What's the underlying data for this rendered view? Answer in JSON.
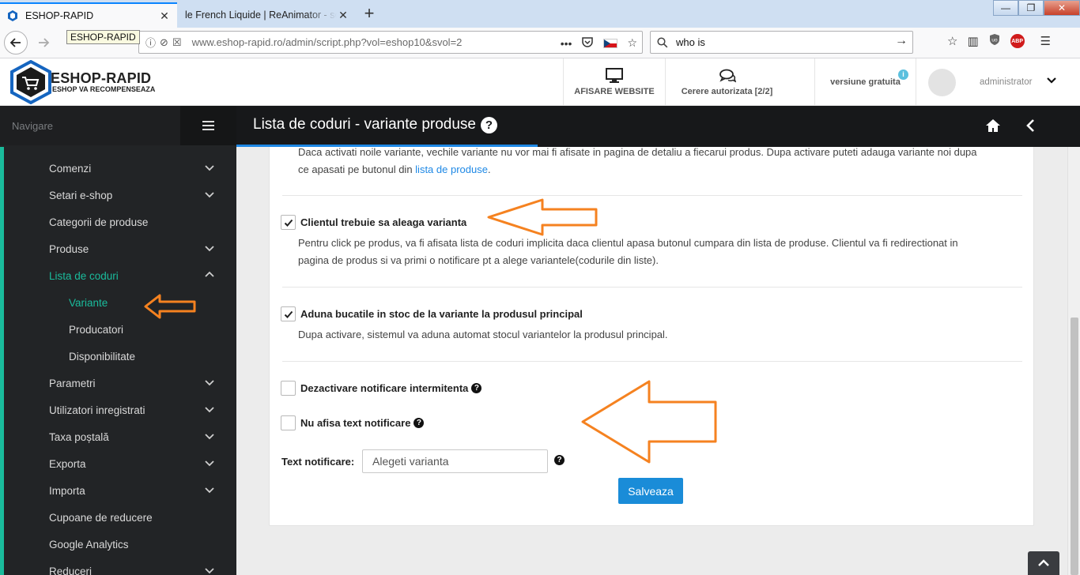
{
  "browser": {
    "tabs": [
      {
        "title": "ESHOP-RAPID",
        "active": true
      },
      {
        "title": "le French Liquide | ReAnimator - sc",
        "active": false
      }
    ],
    "tooltip": "ESHOP-RAPID",
    "url": "www.eshop-rapid.ro/admin/script.php?vol=eshop10&svol=2",
    "search_value": "who is"
  },
  "header": {
    "logo_title": "ESHOP-RAPID",
    "logo_subtitle": "ESHOP VA RECOMPENSEAZA",
    "view_website": "AFISARE WEBSITE",
    "auth_requests": "Cerere autorizata [2/2]",
    "version": "versiune gratuita",
    "version_info": "i",
    "username": "administrator"
  },
  "sidebar": {
    "label": "Navigare",
    "items": [
      {
        "label": "Comenzi",
        "chevron": "down"
      },
      {
        "label": "Setari e-shop",
        "chevron": "down"
      },
      {
        "label": "Categorii de produse",
        "chevron": ""
      },
      {
        "label": "Produse",
        "chevron": "down"
      },
      {
        "label": "Lista de coduri",
        "chevron": "up"
      },
      {
        "label": "Variante",
        "chevron": ""
      },
      {
        "label": "Producatori",
        "chevron": ""
      },
      {
        "label": "Disponibilitate",
        "chevron": ""
      },
      {
        "label": "Parametri",
        "chevron": "down"
      },
      {
        "label": "Utilizatori inregistrati",
        "chevron": "down"
      },
      {
        "label": "Taxa poștală",
        "chevron": "down"
      },
      {
        "label": "Exporta",
        "chevron": "down"
      },
      {
        "label": "Importa",
        "chevron": "down"
      },
      {
        "label": "Cupoane de reducere",
        "chevron": ""
      },
      {
        "label": "Google Analytics",
        "chevron": ""
      },
      {
        "label": "Reduceri",
        "chevron": "down"
      }
    ]
  },
  "page": {
    "title": "Lista de coduri - variante produse",
    "title_help": "?",
    "intro_line1": "Daca activati noile variante, vechile variante nu vor mai fi afisate in pagina de detaliu a fiecarui produs. Dupa activare puteti adauga variante noi dupa",
    "intro_line2": "ce apasati pe butonul  din ",
    "intro_link": "lista de produse",
    "intro_end": ".",
    "opt1_label": "Clientul trebuie sa aleaga varianta",
    "opt1_desc1": "Pentru click pe produs, va fi afisata lista de coduri implicita daca clientul apasa butonul cumpara din lista de produse. Clientul va fi redirectionat in",
    "opt1_desc2": "pagina de produs si va primi o notificare pt a alege variantele(codurile din liste).",
    "opt2_label": "Aduna bucatile in stoc de la variante la produsul principal",
    "opt2_desc": "Dupa activare, sistemul va aduna automat stocul variantelor la produsul principal.",
    "opt3_label": "Dezactivare notificare intermitenta",
    "opt4_label": "Nu afisa text notificare",
    "help": "?",
    "text_label": "Text notificare:",
    "text_value": "Alegeti varianta",
    "save_label": "Salveaza"
  },
  "colors": {
    "accent": "#1abc9c",
    "primary_button": "#1a8cd8",
    "annotation_arrow": "#f58220"
  }
}
